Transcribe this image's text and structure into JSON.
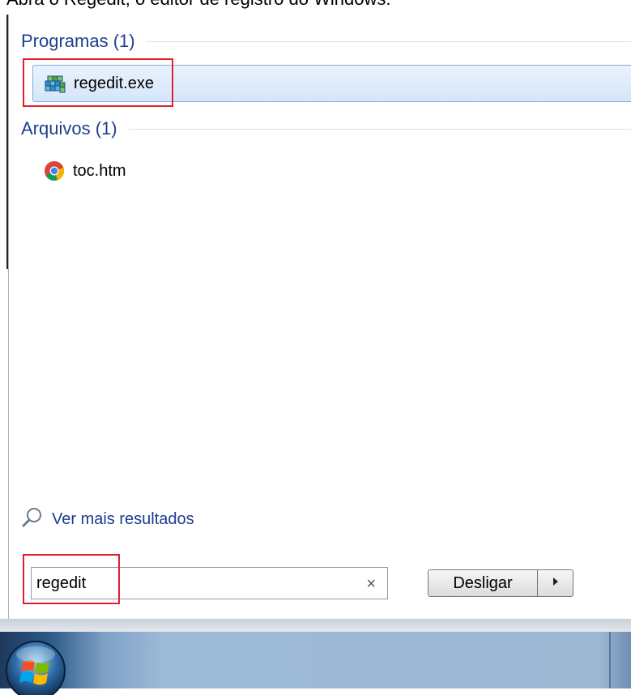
{
  "caption": "Abra o Regedit, o editor de registro do Windows.",
  "start_menu": {
    "sections": [
      {
        "header": "Programas (1)",
        "items": [
          {
            "name": "regedit.exe",
            "icon": "regedit-icon",
            "selected": true
          }
        ]
      },
      {
        "header": "Arquivos (1)",
        "items": [
          {
            "name": "toc.htm",
            "icon": "chrome-icon",
            "selected": false
          }
        ]
      }
    ],
    "more_results": {
      "icon": "search-icon",
      "label": "Ver mais resultados"
    },
    "search": {
      "value": "regedit",
      "clear_icon": "close-icon"
    },
    "shutdown": {
      "label": "Desligar",
      "arrow_icon": "arrow-right-icon"
    }
  },
  "taskbar": {
    "start_icon": "windows-start-orb-icon"
  },
  "colors": {
    "section_header": "#1e3f8f",
    "link": "#1a3c8f",
    "highlight_box": "#e0212b",
    "selected_row": "#d5e6fa"
  }
}
